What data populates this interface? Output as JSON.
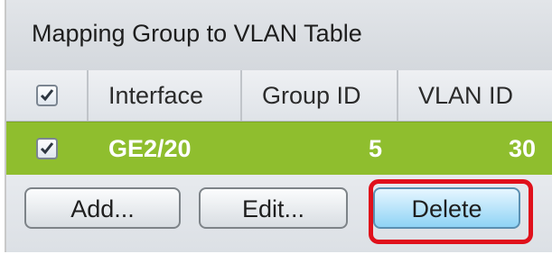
{
  "table": {
    "title": "Mapping Group to VLAN Table",
    "columns": [
      "Interface",
      "Group ID",
      "VLAN ID"
    ],
    "header_checkbox_checked": true,
    "rows": [
      {
        "checked": true,
        "interface": "GE2/20",
        "group_id": "5",
        "vlan_id": "30"
      }
    ]
  },
  "buttons": {
    "add": "Add...",
    "edit": "Edit...",
    "delete": "Delete"
  },
  "colors": {
    "selected_row": "#8fbe2e",
    "highlight": "#e0101b",
    "delete_button": "#8fd3f5"
  },
  "icons": {
    "checkbox_mark": "checkmark-icon"
  }
}
